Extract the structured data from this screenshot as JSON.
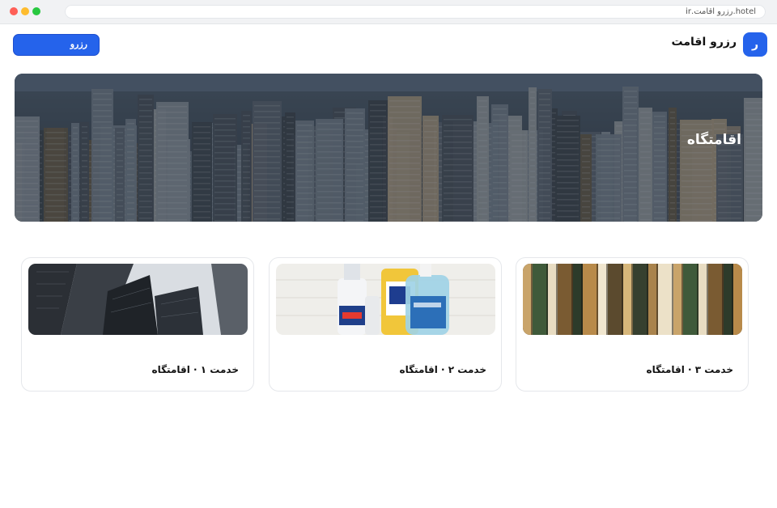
{
  "browser": {
    "url": "hotel.رزرو اقامت.ir"
  },
  "header": {
    "logo_letter": "ر",
    "brand_name": "رزرو اقامت",
    "reserve_label": "رزرو"
  },
  "hero": {
    "title": "اقامتگاه",
    "image": "city-skyline-aerial"
  },
  "cards": [
    {
      "title": "خدمت ۳ · اقامتگاه",
      "image": "clothes-rack"
    },
    {
      "title": "خدمت ۲ · اقامتگاه",
      "image": "cleaning-products"
    },
    {
      "title": "خدمت ۱ · اقامتگاه",
      "image": "skyscrapers"
    }
  ],
  "colors": {
    "accent": "#2563eb"
  }
}
